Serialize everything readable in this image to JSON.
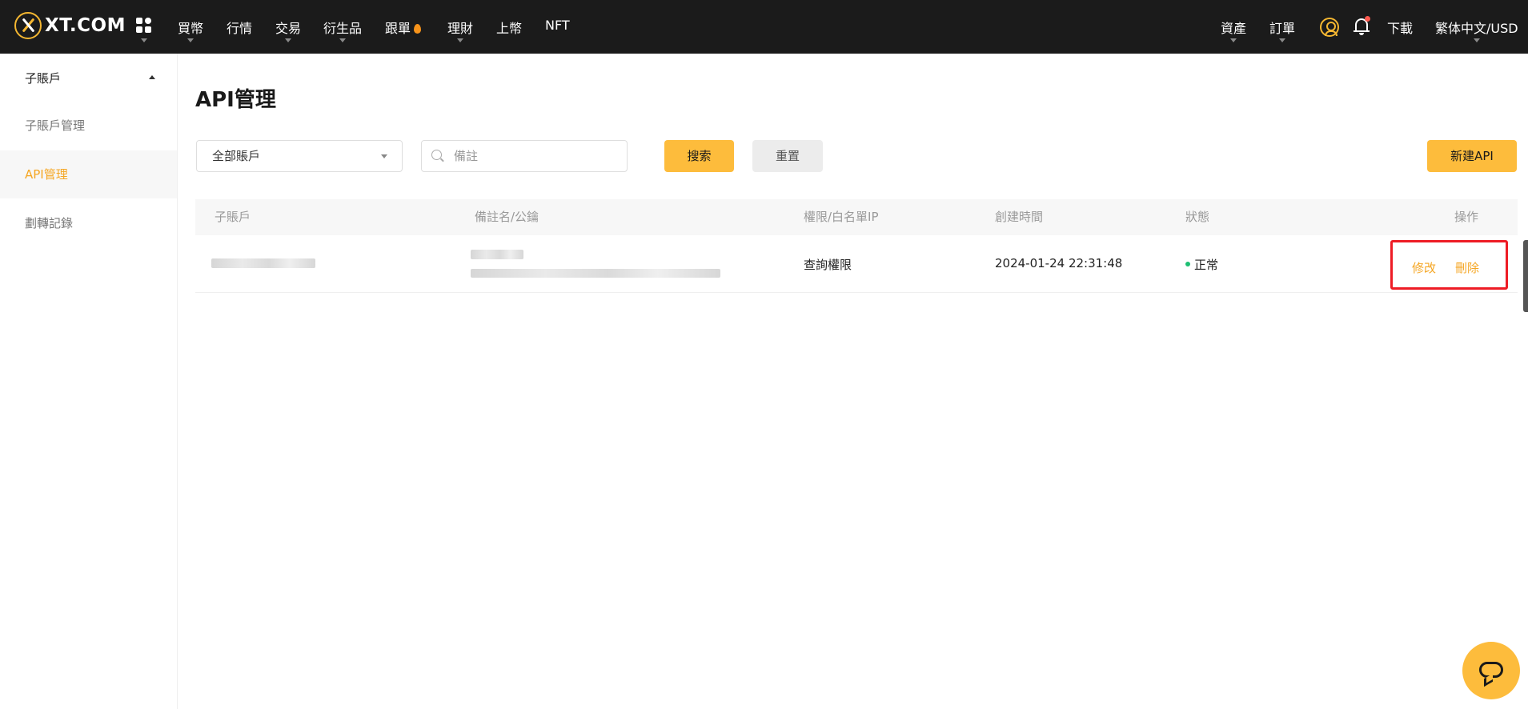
{
  "header": {
    "logo_text": "XT.COM",
    "nav": [
      {
        "label": "買幣"
      },
      {
        "label": "行情"
      },
      {
        "label": "交易"
      },
      {
        "label": "衍生品"
      },
      {
        "label": "跟單"
      },
      {
        "label": "理財"
      },
      {
        "label": "上幣"
      },
      {
        "label": "NFT"
      }
    ],
    "right": {
      "assets": "資產",
      "orders": "訂單",
      "download": "下載",
      "language": "繁体中文/USD"
    },
    "icons": {
      "apps": "grid-icon",
      "user": "user-icon",
      "bell": "bell-icon",
      "hot": "flame-icon"
    },
    "colors": {
      "bg": "#1b1b1b",
      "accent": "#f5b731"
    }
  },
  "sidebar": {
    "group_label": "子賬戶",
    "items": [
      {
        "label": "子賬戶管理",
        "active": false
      },
      {
        "label": "API管理",
        "active": true
      },
      {
        "label": "劃轉記錄",
        "active": false
      }
    ]
  },
  "main": {
    "title": "API管理",
    "filter": {
      "account_select": "全部賬戶",
      "search_placeholder": "備註",
      "search_button": "搜索",
      "reset_button": "重置",
      "new_api_button": "新建API"
    },
    "table": {
      "columns": [
        "子賬戶",
        "備註名/公鑰",
        "權限/白名單IP",
        "創建時間",
        "狀態",
        "操作"
      ],
      "rows": [
        {
          "permission": "查詢權限",
          "created": "2024-01-24 22:31:48",
          "status": "正常",
          "actions": {
            "edit": "修改",
            "delete": "刪除"
          }
        }
      ]
    },
    "colors": {
      "accent": "#fdbc3c",
      "link": "#f5a623",
      "status_ok": "#1dbf73",
      "highlight": "#ee1c25"
    }
  },
  "widgets": {
    "chat_icon": "chat-bubble-icon"
  }
}
